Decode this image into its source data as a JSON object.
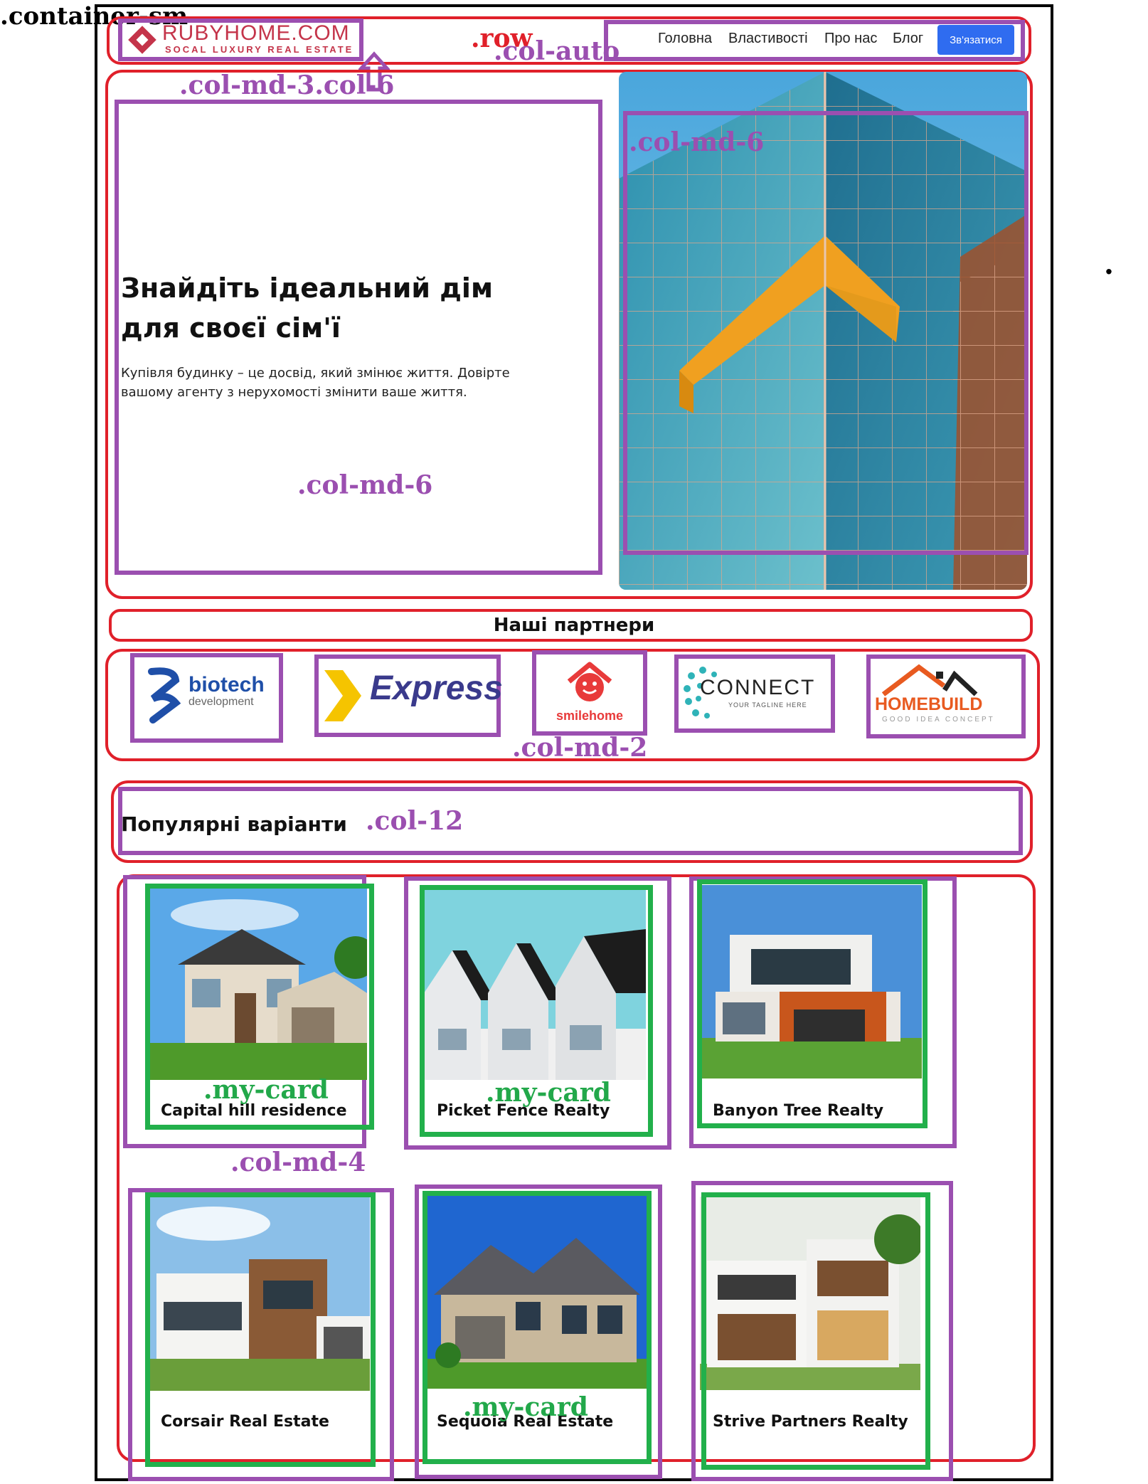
{
  "annotations": {
    "container": ".container-sm",
    "row": ".row",
    "col_auto": ".col-auto",
    "col_md3_col6": ".col-md-3.col-6",
    "col_md6_right": ".col-md-6",
    "col_md6_left": ".col-md-6",
    "col_md2": ".col-md-2",
    "col12": ".col-12",
    "col_md4": ".col-md-4",
    "my_card": ".my-card",
    "stray_dot": "."
  },
  "brand": {
    "name": "RUBYHOME.COM",
    "tagline": "SOCAL LUXURY REAL ESTATE"
  },
  "nav": {
    "items": [
      "Головна",
      "Властивості",
      "Про нас",
      "Блог"
    ],
    "cta": "Зв'язатися"
  },
  "hero": {
    "title_line1": "Знайдіть ідеальний дім",
    "title_line2": "для своєї сім'ї",
    "text_line1": "Купівля будинку – це досвід, який змінює життя. Довірте",
    "text_line2": "вашому агенту з нерухомості змінити ваше життя."
  },
  "partners": {
    "heading": "Наші партнери",
    "logos": [
      {
        "name": "biotech",
        "sub": "development"
      },
      {
        "name": "Express"
      },
      {
        "name": "smilehome"
      },
      {
        "name": "CONNECT",
        "sub": "YOUR TAGLINE HERE"
      },
      {
        "name": "HOMEBUILD",
        "sub": "GOOD IDEA CONCEPT"
      }
    ]
  },
  "popular": {
    "heading": "Популярні варіанти",
    "cards": [
      {
        "title": "Capital hill residence"
      },
      {
        "title": "Picket Fence Realty"
      },
      {
        "title": "Banyon Tree Realty"
      },
      {
        "title": "Corsair Real Estate"
      },
      {
        "title": "Sequoia Real Estate"
      },
      {
        "title": "Strive Partners Realty"
      }
    ]
  },
  "colors": {
    "annotation_red": "#e0202a",
    "annotation_purple": "#9b4fb0",
    "annotation_green": "#22b04b",
    "cta_blue": "#2f6cf0",
    "brand_red": "#c4344a"
  }
}
